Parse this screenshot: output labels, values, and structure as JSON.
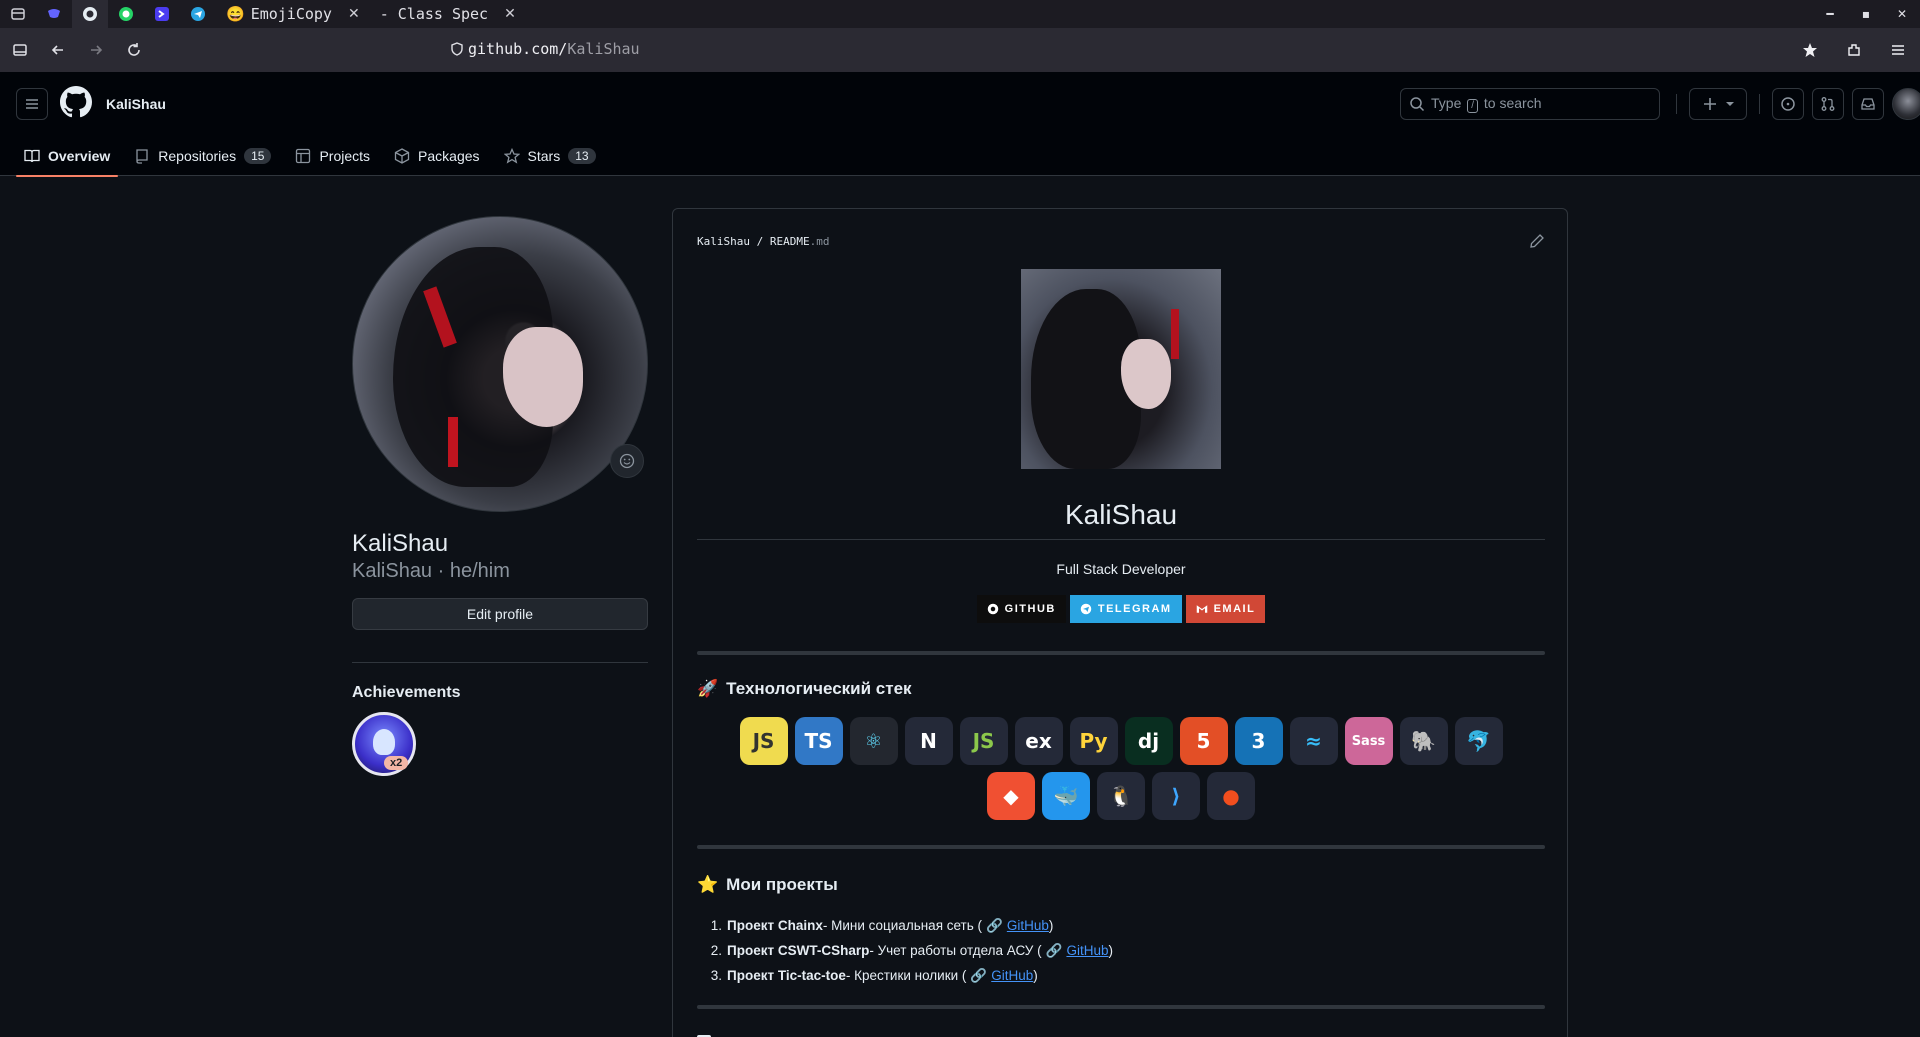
{
  "browser": {
    "tabs": [
      {
        "icon": "mastodon-icon"
      },
      {
        "icon": "github-icon",
        "active": true
      },
      {
        "icon": "whatsapp-icon"
      },
      {
        "icon": "prompt-icon"
      },
      {
        "icon": "telegram-icon"
      }
    ],
    "tab_emojicopy": "EmojiCopy",
    "tab_classspec": "- Class Spec",
    "url_host": "github.com/",
    "url_path": "KaliShau"
  },
  "header": {
    "user": "KaliShau",
    "search_prefix": "Type",
    "search_key": "/",
    "search_suffix": "to search"
  },
  "tabs": [
    {
      "label": "Overview",
      "count": null
    },
    {
      "label": "Repositories",
      "count": "15"
    },
    {
      "label": "Projects",
      "count": null
    },
    {
      "label": "Packages",
      "count": null
    },
    {
      "label": "Stars",
      "count": "13"
    }
  ],
  "profile": {
    "name": "KaliShau",
    "login_pronouns": "KaliShau · he/him",
    "edit_label": "Edit profile",
    "achievements_title": "Achievements",
    "achievement_count": "x2"
  },
  "readme": {
    "path_user": "KaliShau",
    "path_sep": " / ",
    "path_file": "README",
    "path_ext": ".md",
    "title": "KaliShau",
    "subtitle": "Full Stack Developer",
    "badges": [
      {
        "label": "GITHUB",
        "color": "#0d0d0d"
      },
      {
        "label": "TELEGRAM",
        "color": "#2aa5e2"
      },
      {
        "label": "EMAIL",
        "color": "#d14836"
      }
    ],
    "stack_emoji": "🚀",
    "stack_title": "Технологический стек",
    "stack_icons": [
      {
        "name": "js",
        "text": "JS",
        "bg": "#f0db4f",
        "fg": "#323330"
      },
      {
        "name": "ts",
        "text": "TS",
        "bg": "#3178c6",
        "fg": "#ffffff"
      },
      {
        "name": "react",
        "text": "⚛",
        "bg": "#23272f",
        "fg": "#61dafb"
      },
      {
        "name": "nextjs",
        "text": "N",
        "bg": "#242938",
        "fg": "#ffffff"
      },
      {
        "name": "nodejs",
        "text": "JS",
        "bg": "#242938",
        "fg": "#8cc84b"
      },
      {
        "name": "express",
        "text": "ex",
        "bg": "#242938",
        "fg": "#ffffff"
      },
      {
        "name": "python",
        "text": "Py",
        "bg": "#242938",
        "fg": "#ffd43b"
      },
      {
        "name": "django",
        "text": "dj",
        "bg": "#092e20",
        "fg": "#ffffff"
      },
      {
        "name": "html",
        "text": "5",
        "bg": "#e34f26",
        "fg": "#ffffff"
      },
      {
        "name": "css",
        "text": "3",
        "bg": "#1572b6",
        "fg": "#ffffff"
      },
      {
        "name": "tailwind",
        "text": "≈",
        "bg": "#242938",
        "fg": "#38bdf8"
      },
      {
        "name": "sass",
        "text": "Sass",
        "bg": "#cd6799",
        "fg": "#ffffff"
      },
      {
        "name": "postgresql",
        "text": "🐘",
        "bg": "#242938",
        "fg": "#a9c7e8"
      },
      {
        "name": "mysql",
        "text": "🐬",
        "bg": "#242938",
        "fg": "#a9c7e8"
      }
    ],
    "stack_icons_row2": [
      {
        "name": "git",
        "text": "◆",
        "bg": "#f05032",
        "fg": "#ffffff"
      },
      {
        "name": "docker",
        "text": "🐳",
        "bg": "#2496ed",
        "fg": "#ffffff"
      },
      {
        "name": "linux",
        "text": "🐧",
        "bg": "#242938",
        "fg": "#ffffff"
      },
      {
        "name": "vscode",
        "text": "⟩",
        "bg": "#242938",
        "fg": "#3ea6ff"
      },
      {
        "name": "figma",
        "text": "●",
        "bg": "#242938",
        "fg": "#f24e1e"
      }
    ],
    "projects_emoji": "⭐",
    "projects_title": "Мои проекты",
    "projects": [
      {
        "num": "1.",
        "name": "Проект Chainx",
        "desc": " - Мини социальная сеть (",
        "link": "GitHub",
        "end": ")"
      },
      {
        "num": "2.",
        "name": "Проект CSWT-CSharp",
        "desc": " - Учет работы отдела АСУ (",
        "link": "GitHub",
        "end": ")"
      },
      {
        "num": "3.",
        "name": "Проект Tic-tac-toe",
        "desc": " - Крестики нолики (",
        "link": "GitHub",
        "end": ")"
      }
    ]
  }
}
